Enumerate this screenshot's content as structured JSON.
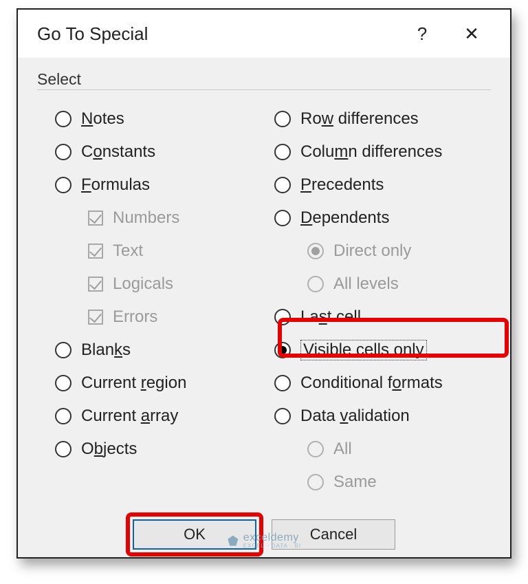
{
  "dialog": {
    "title": "Go To Special",
    "help": "?",
    "close": "✕"
  },
  "group": {
    "label": "Select"
  },
  "left": {
    "notes": "Notes",
    "constants": "Constants",
    "formulas": "Formulas",
    "numbers": "Numbers",
    "text": "Text",
    "logicals": "Logicals",
    "errors": "Errors",
    "blanks": "Blanks",
    "current_region": "Current region",
    "current_array": "Current array",
    "objects": "Objects"
  },
  "right": {
    "row_diff": "Row differences",
    "col_diff": "Column differences",
    "precedents": "Precedents",
    "dependents": "Dependents",
    "direct_only": "Direct only",
    "all_levels": "All levels",
    "last_cell": "Last cell",
    "visible_cells": "Visible cells only",
    "cond_formats": "Conditional formats",
    "data_validation": "Data validation",
    "all": "All",
    "same": "Same"
  },
  "buttons": {
    "ok": "OK",
    "cancel": "Cancel"
  },
  "watermark": {
    "brand": "exceldemy",
    "sub": "EXCEL · DATA · BI"
  },
  "state": {
    "selected_radio": "visible_cells",
    "formula_checks": {
      "numbers": true,
      "text": true,
      "logicals": true,
      "errors": true
    },
    "dependent_level": "direct_only"
  }
}
